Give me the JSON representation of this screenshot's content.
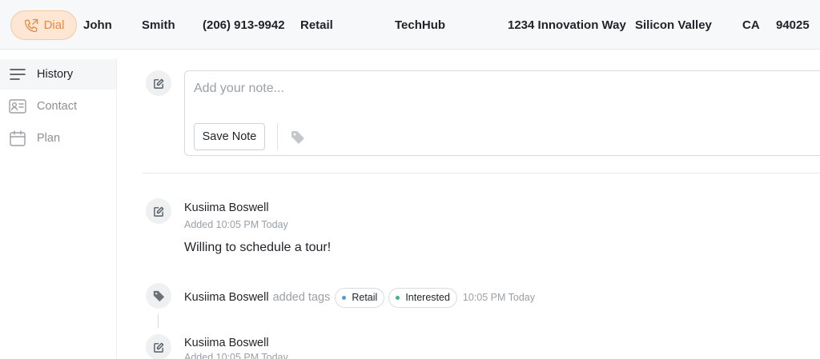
{
  "header": {
    "dial_label": "Dial",
    "first_name": "John",
    "last_name": "Smith",
    "phone": "(206) 913-9942",
    "segment": "Retail",
    "company": "TechHub",
    "address": "1234 Innovation Way",
    "city": "Silicon Valley",
    "state": "CA",
    "zip": "94025"
  },
  "sidebar": {
    "items": [
      {
        "label": "History",
        "icon": "menu-lines-icon",
        "active": true
      },
      {
        "label": "Contact",
        "icon": "contact-card-icon",
        "active": false
      },
      {
        "label": "Plan",
        "icon": "calendar-icon",
        "active": false
      }
    ]
  },
  "editor": {
    "placeholder": "Add your note...",
    "value": "",
    "save_label": "Save Note",
    "tag_icon": "tag-icon"
  },
  "feed": [
    {
      "type": "note",
      "author": "Kusiima Boswell",
      "meta": "Added 10:05 PM Today",
      "body": "Willing to schedule a tour!"
    },
    {
      "type": "tags",
      "author": "Kusiima Boswell",
      "action": "added tags",
      "tags": [
        {
          "label": "Retail",
          "color": "#4a9fd8"
        },
        {
          "label": "Interested",
          "color": "#3fb38a"
        }
      ],
      "time": "10:05 PM Today"
    },
    {
      "type": "note",
      "author": "Kusiima Boswell",
      "meta": "Added 10:05 PM Today"
    }
  ],
  "colors": {
    "dial_accent": "#e88a45",
    "header_bg": "#f7f8fa"
  }
}
